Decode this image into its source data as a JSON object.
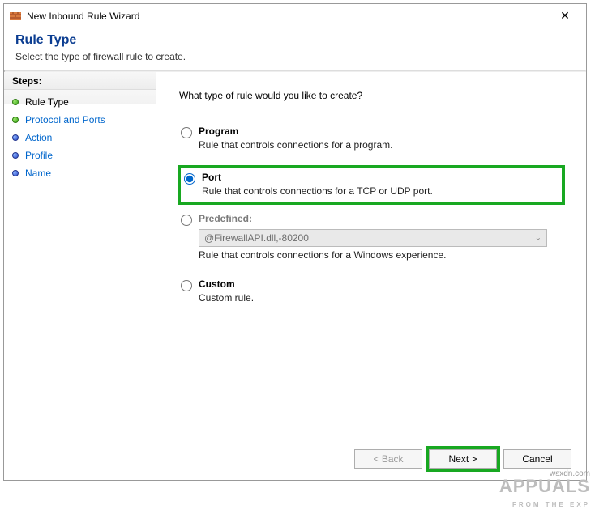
{
  "window": {
    "title": "New Inbound Rule Wizard",
    "close_label": "✕"
  },
  "header": {
    "title": "Rule Type",
    "subtitle": "Select the type of firewall rule to create."
  },
  "sidebar": {
    "header": "Steps:",
    "items": [
      {
        "label": "Rule Type",
        "bullet": "green",
        "state": "current"
      },
      {
        "label": "Protocol and Ports",
        "bullet": "green",
        "state": "link"
      },
      {
        "label": "Action",
        "bullet": "blue",
        "state": "link"
      },
      {
        "label": "Profile",
        "bullet": "blue",
        "state": "link"
      },
      {
        "label": "Name",
        "bullet": "blue",
        "state": "link"
      }
    ]
  },
  "content": {
    "prompt": "What type of rule would you like to create?",
    "options": {
      "program": {
        "title": "Program",
        "desc": "Rule that controls connections for a program.",
        "selected": false
      },
      "port": {
        "title": "Port",
        "desc": "Rule that controls connections for a TCP or UDP port.",
        "selected": true
      },
      "predefined": {
        "title": "Predefined:",
        "select_value": "@FirewallAPI.dll,-80200",
        "desc": "Rule that controls connections for a Windows experience.",
        "selected": false,
        "disabled": true
      },
      "custom": {
        "title": "Custom",
        "desc": "Custom rule.",
        "selected": false
      }
    }
  },
  "footer": {
    "back": "< Back",
    "next": "Next >",
    "cancel": "Cancel"
  },
  "watermark": {
    "brand": "APPUALS",
    "tag": "FROM THE EXP",
    "site": "wsxdn.com"
  }
}
